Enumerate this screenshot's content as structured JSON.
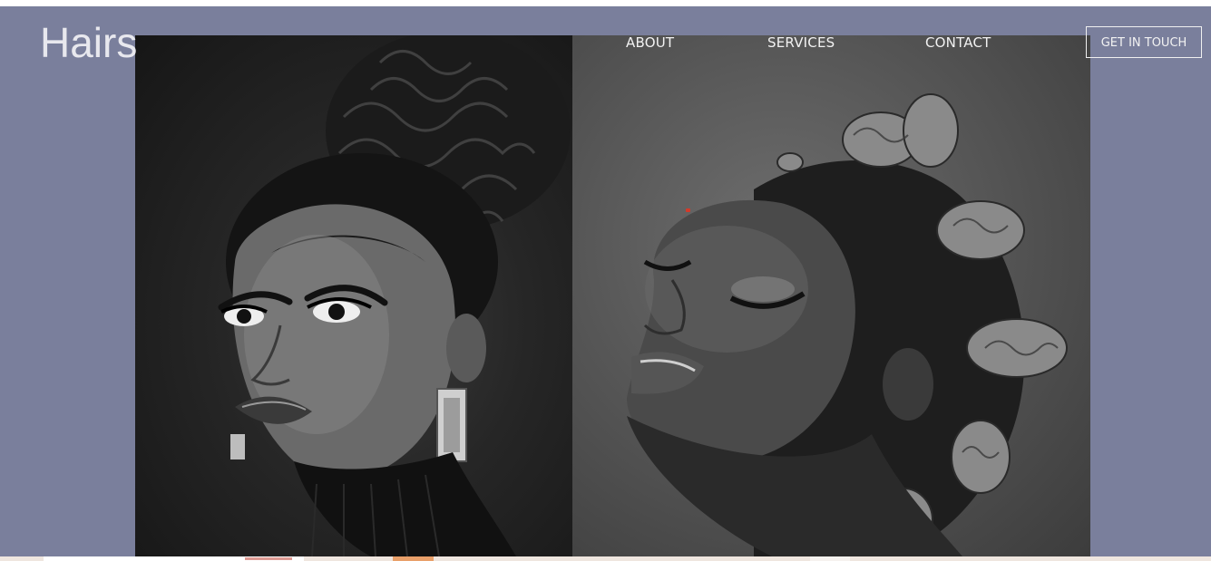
{
  "brand": {
    "logo_text": "Hairs"
  },
  "nav": {
    "items": [
      {
        "label": "ABOUT"
      },
      {
        "label": "SERVICES"
      },
      {
        "label": "CONTACT"
      }
    ],
    "cta_label": "GET IN TOUCH"
  },
  "hero": {
    "background_color": "#7a7f9c",
    "images": [
      {
        "subject": "portrait-woman-braided-bun-earrings"
      },
      {
        "subject": "portrait-woman-bantu-knots-eyes-closed"
      }
    ]
  },
  "colors": {
    "text": "#f2f2f2",
    "logo": "#e8e8ee"
  }
}
